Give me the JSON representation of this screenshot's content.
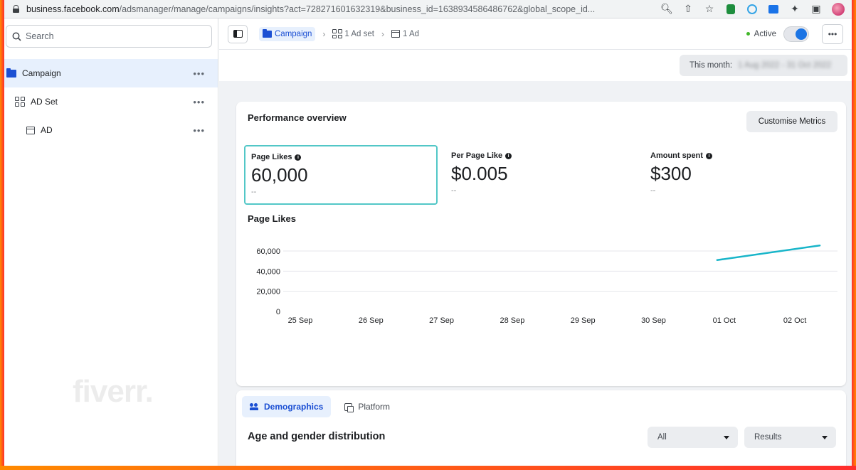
{
  "browser": {
    "url_host": "business.facebook.com",
    "url_path": "/adsmanager/manage/campaigns/insights?act=728271601632319&business_id=1638934586486762&global_scope_id..."
  },
  "sidebar": {
    "search_placeholder": "Search",
    "items": [
      {
        "label": "Campaign",
        "icon": "folder-icon",
        "more": "•••"
      },
      {
        "label": "AD Set",
        "icon": "grid-icon",
        "more": "•••"
      },
      {
        "label": "AD",
        "icon": "ad-icon",
        "more": "•••"
      }
    ]
  },
  "toolbar": {
    "breadcrumbs": [
      "Campaign",
      "1 Ad set",
      "1 Ad"
    ],
    "status": "Active",
    "more": "•••"
  },
  "date_range": {
    "label": "This month:",
    "value_blurred": "1 Aug 2022 - 31 Oct 2022"
  },
  "performance": {
    "title": "Performance overview",
    "customise_label": "Customise Metrics",
    "metrics": [
      {
        "label": "Page Likes",
        "value": "60,000",
        "sub": "--"
      },
      {
        "label": "Per Page Like",
        "value": "$0.005",
        "sub": "--"
      },
      {
        "label": "Amount spent",
        "value": "$300",
        "sub": "--"
      }
    ]
  },
  "chart_data": {
    "type": "line",
    "title": "Page Likes",
    "xlabel": "",
    "ylabel": "",
    "categories": [
      "25 Sep",
      "26 Sep",
      "27 Sep",
      "28 Sep",
      "29 Sep",
      "30 Sep",
      "01 Oct",
      "02 Oct"
    ],
    "yticks": [
      "0",
      "20,000",
      "40,000",
      "60,000"
    ],
    "ylim": [
      0,
      60000
    ],
    "series": [
      {
        "color": "#18b5c9",
        "x": [
          "01 Oct",
          "02 Oct"
        ],
        "values": [
          51000,
          65500
        ]
      }
    ],
    "grid": true
  },
  "demographics": {
    "tabs": [
      "Demographics",
      "Platform"
    ],
    "section_title": "Age and gender distribution",
    "filter_1": "All",
    "filter_2": "Results"
  },
  "watermark": "fiverr."
}
